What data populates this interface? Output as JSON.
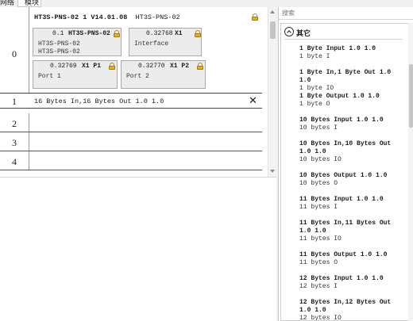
{
  "tabs": [
    "网络",
    "模块"
  ],
  "device": {
    "title_prefix": "HT3S-PNS-02 1 V14.01.08",
    "title_name": "HT3S-PNS-02"
  },
  "slot_numbers": [
    "0",
    "1",
    "2",
    "3",
    "4"
  ],
  "modules": [
    {
      "num": "0.1",
      "name": "HT3S-PNS-02",
      "lines": [
        "HT3S-PNS-02",
        "HT3S-PNS-02"
      ]
    },
    {
      "num": "0.32768",
      "name": "X1",
      "lines": [
        "Interface"
      ]
    },
    {
      "num": "0.32769",
      "name": "X1 P1",
      "lines": [
        "Port 1"
      ]
    },
    {
      "num": "0.32770",
      "name": "X1 P2",
      "lines": [
        "Port 2"
      ]
    }
  ],
  "slot1_module": "16 Bytes In,16 Bytes Out 1.0 1.0",
  "slot1_remove_glyph": "✕",
  "search": {
    "placeholder": "搜索"
  },
  "catalog": {
    "category": "其它",
    "items": [
      {
        "title": "1 Byte Input 1.0 1.0",
        "sub": "1 byte I"
      },
      {
        "title": "1 Byte In,1 Byte Out 1.0 1.0",
        "sub": "1 byte IO"
      },
      {
        "title": "1 Byte Output 1.0 1.0",
        "sub": "1 byte O"
      },
      {
        "title": "10 Bytes Input 1.0 1.0",
        "sub": "10 bytes I"
      },
      {
        "title": "10 Bytes In,10 Bytes Out 1.0 1.0",
        "sub": "10 bytes IO"
      },
      {
        "title": "10 Bytes Output 1.0 1.0",
        "sub": "10 bytes O"
      },
      {
        "title": "11 Bytes Input 1.0 1.0",
        "sub": "11 bytes I"
      },
      {
        "title": "11 Bytes In,11 Bytes Out 1.0 1.0",
        "sub": "11 bytes IO"
      },
      {
        "title": "11 Bytes Output 1.0 1.0",
        "sub": "11 bytes O"
      },
      {
        "title": "12 Bytes Input 1.0 1.0",
        "sub": "12 bytes I"
      },
      {
        "title": "12 Bytes In,12 Bytes Out 1.0 1.0",
        "sub": "12 bytes IO"
      }
    ]
  },
  "colors": {
    "lock": "#e2b21a",
    "module_bg": "#ececec",
    "border": "#a9a9a9"
  }
}
